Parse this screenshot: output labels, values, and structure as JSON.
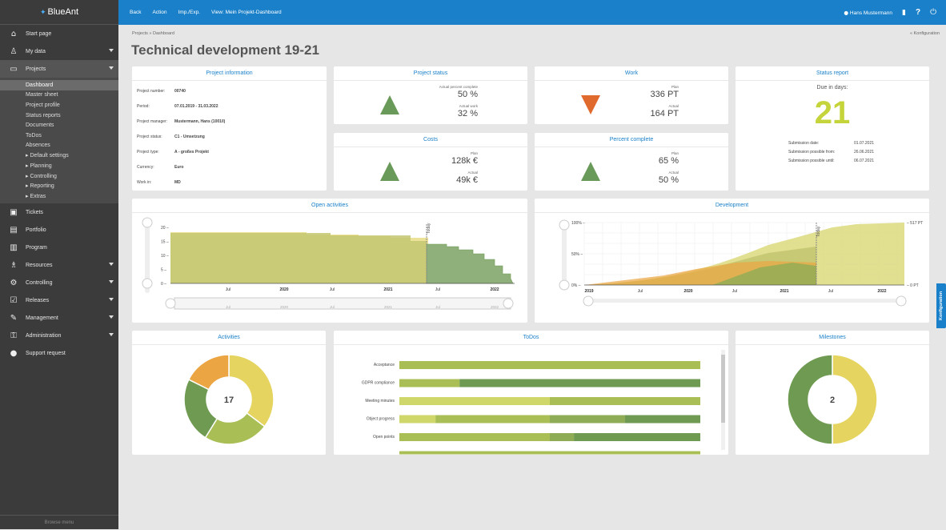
{
  "app": {
    "logo": "BlueAnt"
  },
  "nav": {
    "items": [
      {
        "icon": "⌂",
        "label": "Start page",
        "arrow": false
      },
      {
        "icon": "♙",
        "label": "My data",
        "arrow": true
      },
      {
        "icon": "▭",
        "label": "Projects",
        "arrow": true
      }
    ],
    "project_sub": [
      "Dashboard",
      "Master sheet",
      "Project profile",
      "Status reports",
      "Documents",
      "ToDos",
      "Absences",
      "▸ Default settings",
      "▸ Planning",
      "▸ Controlling",
      "▸ Reporting",
      "▸ Extras"
    ],
    "items2": [
      {
        "icon": "▣",
        "label": "Tickets",
        "arrow": false
      },
      {
        "icon": "▤",
        "label": "Portfolio",
        "arrow": false
      },
      {
        "icon": "▥",
        "label": "Program",
        "arrow": false
      },
      {
        "icon": "♗",
        "label": "Resources",
        "arrow": true
      },
      {
        "icon": "⚙",
        "label": "Controlling",
        "arrow": true
      },
      {
        "icon": "☑",
        "label": "Releases",
        "arrow": true
      },
      {
        "icon": "✎",
        "label": "Management",
        "arrow": true
      },
      {
        "icon": "⚿",
        "label": "Administration",
        "arrow": true
      },
      {
        "icon": "●",
        "label": "Support request",
        "arrow": false
      }
    ],
    "browse": "Browse menu"
  },
  "topbar": {
    "back": "Back",
    "action": "Action",
    "impexp": "Imp./Exp.",
    "view": "View: Mein Projekt-Dashboard",
    "user": "Hans Mustermann"
  },
  "crumb": "Projects  »  Dashboard",
  "konfig": "« Konfiguration",
  "title": "Technical development 19-21",
  "project_info": {
    "title": "Project information",
    "rows": [
      {
        "l": "Project number:",
        "v": "00740"
      },
      {
        "l": "Period:",
        "v": "07.01.2019 - 31.03.2022"
      },
      {
        "l": "Project manager:",
        "v": "Mustermann, Hans (1001/I)"
      },
      {
        "l": "Project status:",
        "v": "C1 - Umsetzung"
      },
      {
        "l": "Project type:",
        "v": "A - großes Projekt"
      },
      {
        "l": "Currency:",
        "v": "Euro"
      },
      {
        "l": "Work in:",
        "v": "MD"
      }
    ]
  },
  "project_status": {
    "title": "Project status",
    "l1": "Actual percent complete",
    "v1": "50 %",
    "l2": "Actual work",
    "v2": "32 %"
  },
  "work": {
    "title": "Work",
    "l1": "Plan",
    "v1": "336 PT",
    "l2": "Actual",
    "v2": "164 PT"
  },
  "costs": {
    "title": "Costs",
    "l1": "Plan",
    "v1": "128k €",
    "l2": "Actual",
    "v2": "49k €"
  },
  "percent": {
    "title": "Percent complete",
    "l1": "Plan",
    "v1": "65 %",
    "l2": "Actual",
    "v2": "50 %"
  },
  "status_report": {
    "title": "Status report",
    "due_label": "Due in days:",
    "due": "21",
    "rows": [
      {
        "l": "Submission date:",
        "v": "01.07.2021"
      },
      {
        "l": "Submission possible from:",
        "v": "26.06.2021"
      },
      {
        "l": "Submission possible until:",
        "v": "06.07.2021"
      }
    ]
  },
  "open_activities": {
    "title": "Open activities",
    "yticks": [
      "20",
      "15",
      "10",
      "5",
      "0"
    ],
    "xticks": [
      "Jul",
      "2020",
      "Jul",
      "2021",
      "Jul",
      "2022"
    ],
    "today": "Today"
  },
  "development": {
    "title": "Development",
    "yticks": [
      "100%",
      "50%",
      "0%"
    ],
    "xticks": [
      "2019",
      "Jul",
      "2020",
      "Jul",
      "2021",
      "Jul",
      "2022"
    ],
    "right_top": "517 PT",
    "right_bottom": "0 PT",
    "today": "Today"
  },
  "activities": {
    "title": "Activities",
    "center": "17",
    "segments": [
      {
        "value": 6,
        "color": "#e6d461"
      },
      {
        "value": 4,
        "color": "#a9bf55"
      },
      {
        "value": 4,
        "color": "#6e9a52"
      },
      {
        "value": 3,
        "color": "#eba543"
      }
    ]
  },
  "todos": {
    "title": "ToDos",
    "rows": [
      {
        "label": "Acceptance",
        "segments": [
          {
            "value": 100,
            "color": "#a9bf55"
          }
        ]
      },
      {
        "label": "GDPR compliance",
        "segments": [
          {
            "value": 20,
            "color": "#a9bf55"
          },
          {
            "value": 80,
            "color": "#6e9a52"
          }
        ]
      },
      {
        "label": "Meeting minutes",
        "segments": [
          {
            "value": 50,
            "color": "#cfd66a"
          },
          {
            "value": 50,
            "color": "#a9bf55"
          }
        ]
      },
      {
        "label": "Object progress",
        "segments": [
          {
            "value": 12,
            "color": "#cfd66a"
          },
          {
            "value": 38,
            "color": "#a9bf55"
          },
          {
            "value": 25,
            "color": "#8eac55"
          },
          {
            "value": 25,
            "color": "#6e9a52"
          }
        ]
      },
      {
        "label": "Open points",
        "segments": [
          {
            "value": 50,
            "color": "#a9bf55"
          },
          {
            "value": 8,
            "color": "#8eac55"
          },
          {
            "value": 42,
            "color": "#6e9a52"
          }
        ]
      }
    ]
  },
  "milestones": {
    "title": "Milestones",
    "center": "2",
    "segments": [
      {
        "value": 1,
        "color": "#e6d461"
      },
      {
        "value": 1,
        "color": "#6e9a52"
      }
    ]
  },
  "vtab": "Konfiguration"
}
